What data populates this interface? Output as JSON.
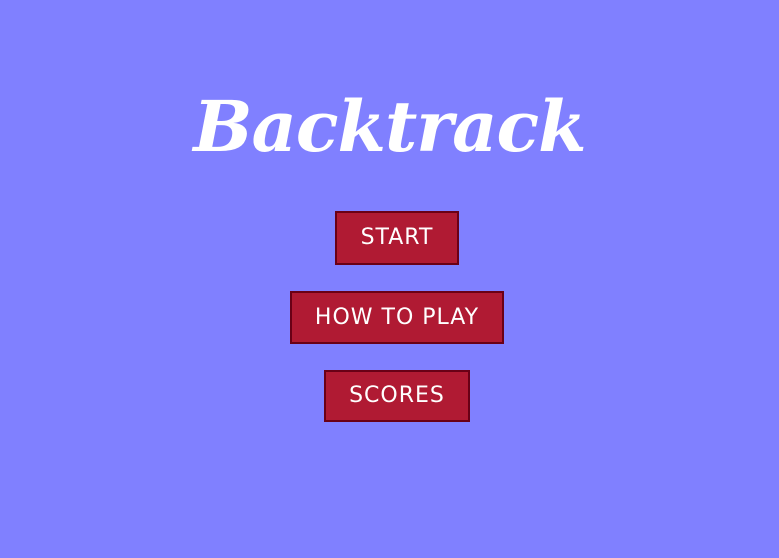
{
  "game": {
    "title": "Backtrack"
  },
  "menu": {
    "start_label": "START",
    "how_to_play_label": "HOW TO PLAY",
    "scores_label": "SCORES"
  },
  "colors": {
    "background": "#8080ff",
    "title": "#ffffff",
    "button_fill": "#b01a33",
    "button_border": "#6a0016",
    "button_text": "#ffffff"
  },
  "icons": {
    "cursor": "mouse-pointer-icon"
  }
}
